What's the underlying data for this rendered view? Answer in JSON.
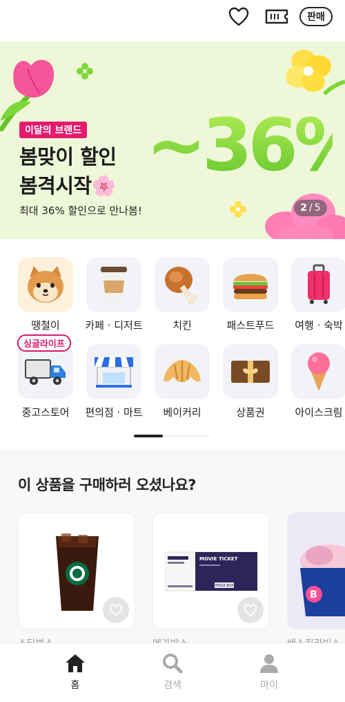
{
  "header": {
    "icons": [
      "heart-icon",
      "ticket-icon"
    ],
    "sell_label": "판매"
  },
  "banner": {
    "tag": "이달의 브랜드",
    "title_line1": "봄맞이 할인",
    "title_line2": "봄격시작🌸",
    "subtitle": "최대 36% 할인으로 만나봄!",
    "discount_text": "~36%",
    "page_current": "2",
    "page_sep": "/",
    "page_total": "5",
    "colors": {
      "background": "#eef8d8",
      "tag": "#e6196e",
      "accent": "#7dd63a"
    }
  },
  "categories": [
    {
      "label": "땡철이",
      "icon": "shiba-dog-icon"
    },
    {
      "label": "카페 · 디저트",
      "icon": "coffee-cup-icon"
    },
    {
      "label": "치킨",
      "icon": "chicken-leg-icon"
    },
    {
      "label": "패스트푸드",
      "icon": "burger-icon"
    },
    {
      "label": "여행 · 숙박",
      "icon": "suitcase-icon"
    },
    {
      "label": "중고스토어",
      "icon": "truck-icon",
      "badge": "싱글라이프"
    },
    {
      "label": "편의점 · 마트",
      "icon": "store-icon"
    },
    {
      "label": "베이커리",
      "icon": "croissant-icon"
    },
    {
      "label": "상품권",
      "icon": "gift-voucher-icon"
    },
    {
      "label": "아이스크림",
      "icon": "ice-cream-cone-icon"
    }
  ],
  "section": {
    "title": "이 상품을 구매하러 오셨나요?",
    "products": [
      {
        "name": "스타벅스",
        "image": "iced-coffee-icon"
      },
      {
        "name": "메가박스",
        "image": "movie-ticket-icon"
      },
      {
        "name": "배스킨라빈스",
        "image": "ice-cream-cup-icon"
      }
    ],
    "ticket_text": {
      "movie": "MOVIE TICKET",
      "stub": "MEGA BOX"
    }
  },
  "bottom_nav": [
    {
      "label": "홈",
      "icon": "home-icon",
      "active": true
    },
    {
      "label": "검색",
      "icon": "search-icon",
      "active": false
    },
    {
      "label": "마이",
      "icon": "person-icon",
      "active": false
    }
  ]
}
